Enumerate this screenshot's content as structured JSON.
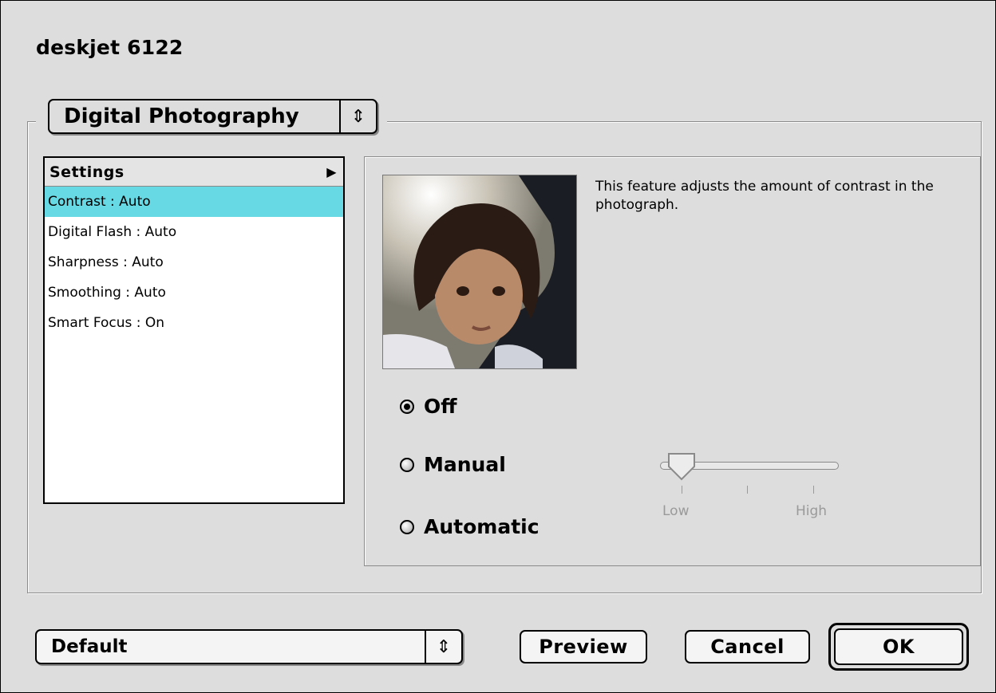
{
  "window": {
    "title": "deskjet 6122"
  },
  "panel_selector": {
    "value": "Digital Photography"
  },
  "settings_list": {
    "header": "Settings",
    "items": [
      {
        "label": "Contrast : Auto",
        "selected": true
      },
      {
        "label": "Digital Flash : Auto",
        "selected": false
      },
      {
        "label": "Sharpness : Auto",
        "selected": false
      },
      {
        "label": "Smoothing : Auto",
        "selected": false
      },
      {
        "label": "Smart Focus : On",
        "selected": false
      }
    ]
  },
  "detail": {
    "description": "This feature adjusts the amount of contrast in the photograph.",
    "options": [
      {
        "label": "Off",
        "checked": true
      },
      {
        "label": "Manual",
        "checked": false
      },
      {
        "label": "Automatic",
        "checked": false
      }
    ],
    "slider": {
      "low_label": "Low",
      "high_label": "High",
      "level": 0.0,
      "enabled": false
    }
  },
  "footer": {
    "preset": "Default",
    "preview_label": "Preview",
    "cancel_label": "Cancel",
    "ok_label": "OK"
  },
  "colors": {
    "selection": "#66d9e4",
    "background": "#dddddd"
  }
}
